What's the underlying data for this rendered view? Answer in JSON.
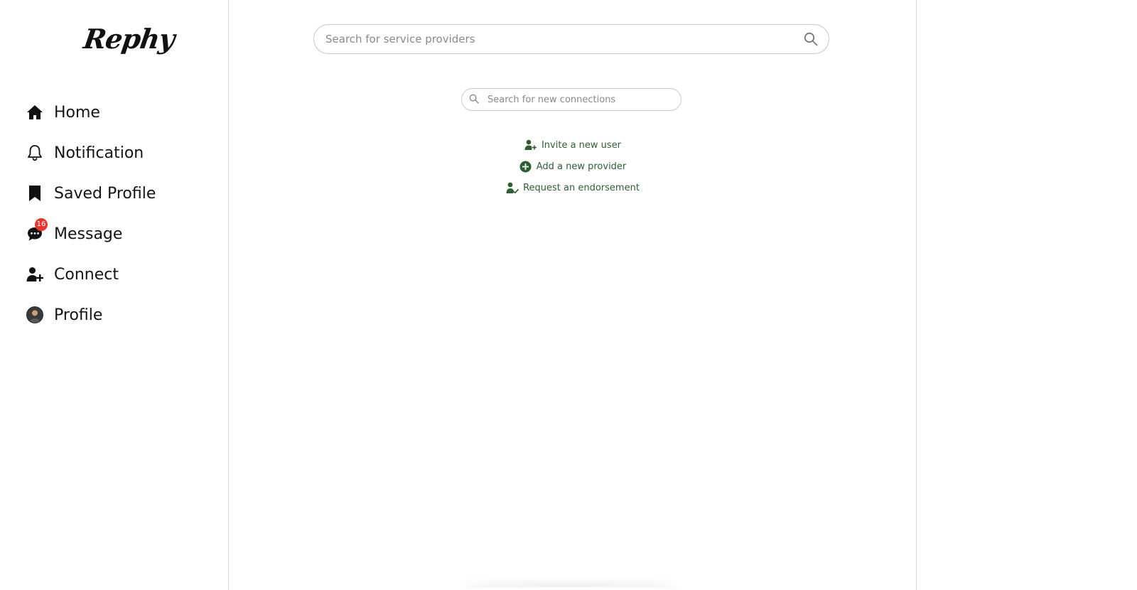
{
  "brand": {
    "logo_text": "Rephy"
  },
  "sidebar": {
    "items": [
      {
        "label": "Home",
        "icon": "home-icon"
      },
      {
        "label": "Notification",
        "icon": "bell-icon"
      },
      {
        "label": "Saved Profile",
        "icon": "bookmark-icon"
      },
      {
        "label": "Message",
        "icon": "chat-icon",
        "badge": "16"
      },
      {
        "label": "Connect",
        "icon": "user-plus-icon"
      },
      {
        "label": "Profile",
        "icon": "avatar"
      }
    ]
  },
  "main": {
    "provider_search": {
      "placeholder": "Search for service providers",
      "value": ""
    },
    "connection_search": {
      "placeholder": "Search for new connections",
      "value": ""
    },
    "actions": [
      {
        "label": "Invite a new user",
        "icon": "user-plus-icon"
      },
      {
        "label": "Add a new provider",
        "icon": "plus-circle-icon"
      },
      {
        "label": "Request an endorsement",
        "icon": "user-check-icon"
      }
    ]
  },
  "colors": {
    "accent_green": "#2f5e34",
    "badge_red": "#e8352c",
    "border": "#c8c8c8",
    "divider": "#d9d9d9"
  }
}
